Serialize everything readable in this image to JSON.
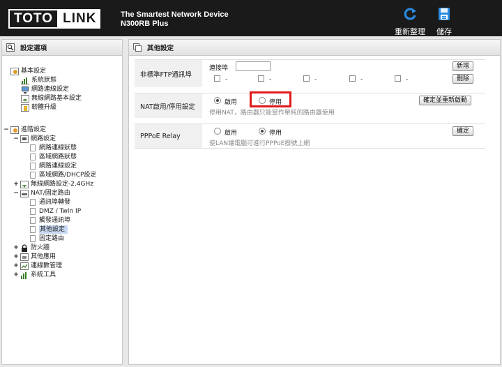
{
  "header": {
    "logo_left": "TOTO",
    "logo_right": "LINK",
    "tagline_line1": "The Smartest Network Device",
    "tagline_line2": "N300RB Plus",
    "refresh_label": "重新整理",
    "save_label": "儲存"
  },
  "sidebar": {
    "title": "設定選項",
    "basic": {
      "label": "基本設定",
      "items": [
        "系統狀態",
        "網路連線設定",
        "無線網路基本設定",
        "韌體升級"
      ]
    },
    "advanced": {
      "label": "進階設定",
      "network": {
        "label": "網路設定",
        "items": [
          "網路連線狀態",
          "區域網路狀態",
          "網路連線設定",
          "區域網路/DHCP設定"
        ]
      },
      "wireless_label": "無線網路設定-2.4GHz",
      "nat": {
        "label": "NAT/固定路由",
        "items": [
          "通訊埠轉發",
          "DMZ / Twin IP",
          "觸發通訊埠",
          "其他設定",
          "固定路由"
        ],
        "selected_index": 3
      },
      "others": [
        "防火牆",
        "其他應用",
        "連線數管理",
        "系統工具"
      ]
    }
  },
  "main": {
    "title": "其他設定",
    "ftp": {
      "label": "非標準FTP通訊埠",
      "port_label": "連接埠",
      "port_value": "",
      "slot_values": [
        "-",
        "-",
        "-",
        "-",
        "-"
      ],
      "add_button": "新增",
      "delete_button": "刪除"
    },
    "nat": {
      "label": "NAT啟用/停用設定",
      "enable_label": "啟用",
      "disable_label": "停用",
      "selected": "enable",
      "hint": "停用NAT，路由器只能當作單純的路由器使用",
      "apply_button": "確定並重新啟動"
    },
    "pppoe": {
      "label": "PPPoE Relay",
      "enable_label": "啟用",
      "disable_label": "停用",
      "selected": "disable",
      "hint": "使LAN端電腦可進行PPPoE撥號上網",
      "apply_button": "確定"
    }
  },
  "colors": {
    "header_bg": "#1a1a1a",
    "accent_blue": "#1f6fc6",
    "highlight_red": "#e01919",
    "selected_bg": "#c7d9f1"
  }
}
